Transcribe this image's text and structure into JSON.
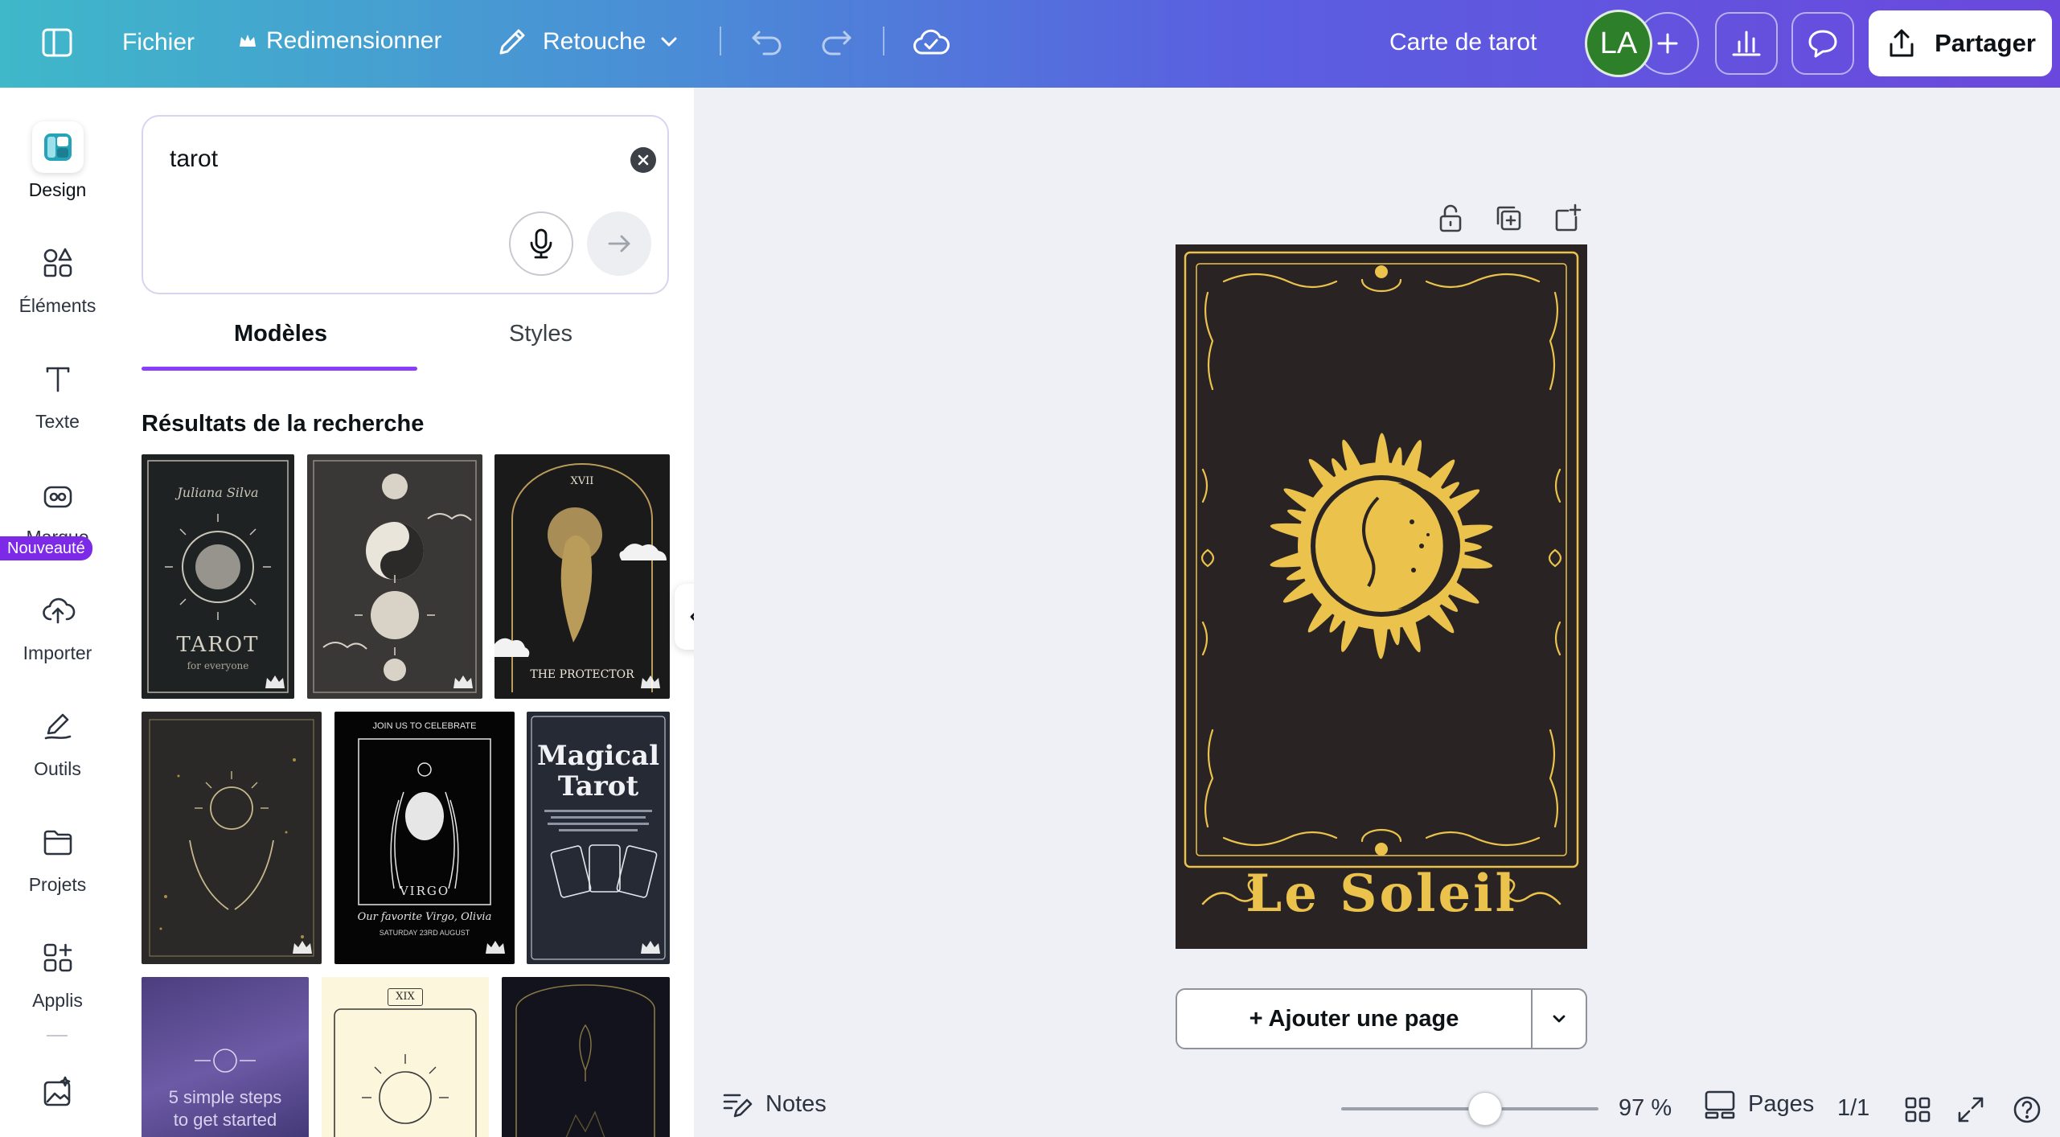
{
  "topbar": {
    "file_label": "Fichier",
    "resize_label": "Redimensionner",
    "edit_label": "Retouche",
    "doc_title": "Carte de tarot",
    "avatar_initials": "LA",
    "share_label": "Partager"
  },
  "rail": {
    "items": [
      {
        "label": "Design",
        "icon": "design-icon"
      },
      {
        "label": "Éléments",
        "icon": "elements-icon"
      },
      {
        "label": "Texte",
        "icon": "text-icon"
      },
      {
        "label": "Marque",
        "icon": "brand-icon"
      },
      {
        "label": "Importer",
        "icon": "upload-cloud-icon"
      },
      {
        "label": "Outils",
        "icon": "tools-icon"
      },
      {
        "label": "Projets",
        "icon": "folder-icon"
      },
      {
        "label": "Applis",
        "icon": "apps-icon"
      }
    ],
    "new_badge": "Nouveauté"
  },
  "panel": {
    "search_value": "tarot",
    "tabs": [
      {
        "label": "Modèles"
      },
      {
        "label": "Styles"
      }
    ],
    "active_tab": "Modèles",
    "results_title": "Résultats de la recherche",
    "templates": [
      {
        "title": "Juliana Silva",
        "main": "TAROT",
        "sub": "for everyone"
      },
      {
        "title": "",
        "main": "",
        "sub": ""
      },
      {
        "title": "XVII",
        "main": "THE PROTECTOR",
        "sub": ""
      },
      {
        "title": "",
        "main": "",
        "sub": ""
      },
      {
        "title": "JOIN US TO CELEBRATE",
        "main": "VIRGO",
        "sub": "Our favorite Virgo, Olivia",
        "detail": "SATURDAY 23RD AUGUST"
      },
      {
        "title": "Magical",
        "main": "Tarot",
        "sub": ""
      },
      {
        "title": "5 simple steps",
        "main": "to get started",
        "sub": ""
      },
      {
        "title": "XIX",
        "main": "",
        "sub": ""
      },
      {
        "title": "",
        "main": "",
        "sub": ""
      }
    ]
  },
  "canvas": {
    "card_title": "Le Soleil",
    "add_page_label": "+ Ajouter une page"
  },
  "bottombar": {
    "notes_label": "Notes",
    "zoom_percent": 97,
    "zoom_label": "97 %",
    "pages_label": "Pages",
    "page_count": "1/1"
  },
  "colors": {
    "accent": "#8b3dff",
    "card_bg": "#2a2323",
    "card_gold": "#eac24c",
    "avatar_bg": "#2d7f2a"
  }
}
